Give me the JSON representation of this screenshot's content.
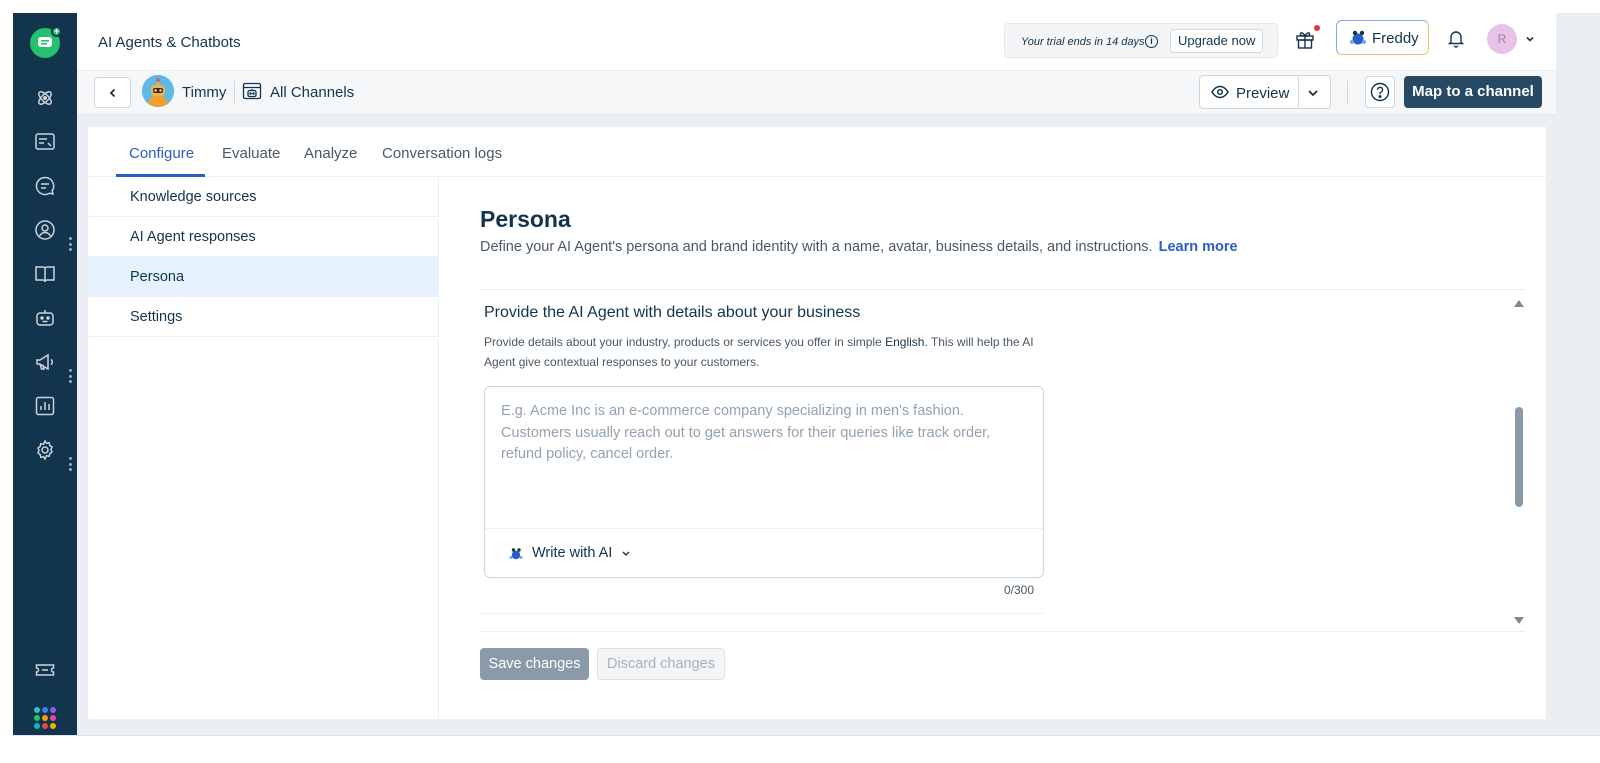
{
  "app": {
    "title": "AI Agents & Chatbots"
  },
  "trial": {
    "text": "Your trial ends in 14 days",
    "upgrade_label": "Upgrade now"
  },
  "header": {
    "freddy_label": "Freddy",
    "avatar_initial": "R"
  },
  "subheader": {
    "bot_name": "Timmy",
    "channel_label": "All Channels",
    "preview_label": "Preview",
    "map_button_label": "Map to a channel"
  },
  "tabs": [
    {
      "label": "Configure",
      "active": true
    },
    {
      "label": "Evaluate",
      "active": false
    },
    {
      "label": "Analyze",
      "active": false
    },
    {
      "label": "Conversation logs",
      "active": false
    }
  ],
  "side_menu": [
    {
      "label": "Knowledge sources",
      "active": false
    },
    {
      "label": "AI Agent responses",
      "active": false
    },
    {
      "label": "Persona",
      "active": true
    },
    {
      "label": "Settings",
      "active": false
    }
  ],
  "persona": {
    "title": "Persona",
    "description": "Define your AI Agent's persona and brand identity with a name, avatar, business details, and instructions.",
    "learn_more": "Learn more"
  },
  "business": {
    "title": "Provide the AI Agent with details about your business",
    "desc_prefix": "Provide details about your industry, products or services you offer in simple ",
    "desc_language": "English",
    "desc_suffix": ". This will help the AI Agent give contextual responses to your customers.",
    "placeholder": "E.g. Acme Inc is an e-commerce company specializing in men's fashion. Customers usually reach out to get answers for their queries like track order, refund policy, cancel order.",
    "value": "",
    "write_with_ai": "Write with AI",
    "char_count": "0/300"
  },
  "actions": {
    "save": "Save changes",
    "discard": "Discard changes"
  },
  "colors": {
    "rail": "#12344d",
    "accent": "#2c5cc5",
    "primary_button": "#264966",
    "active_menu": "#e5f2fd",
    "logo_green": "#25c16f"
  },
  "icons": {
    "rail": [
      "network-icon",
      "inbox-icon",
      "chat-icon",
      "contact-icon",
      "book-icon",
      "bot-icon",
      "megaphone-icon",
      "analytics-icon",
      "settings-icon",
      "ticket-icon",
      "apps-icon"
    ],
    "header": [
      "gift-icon",
      "freddy-icon",
      "bell-icon",
      "chevron-down-icon"
    ]
  }
}
